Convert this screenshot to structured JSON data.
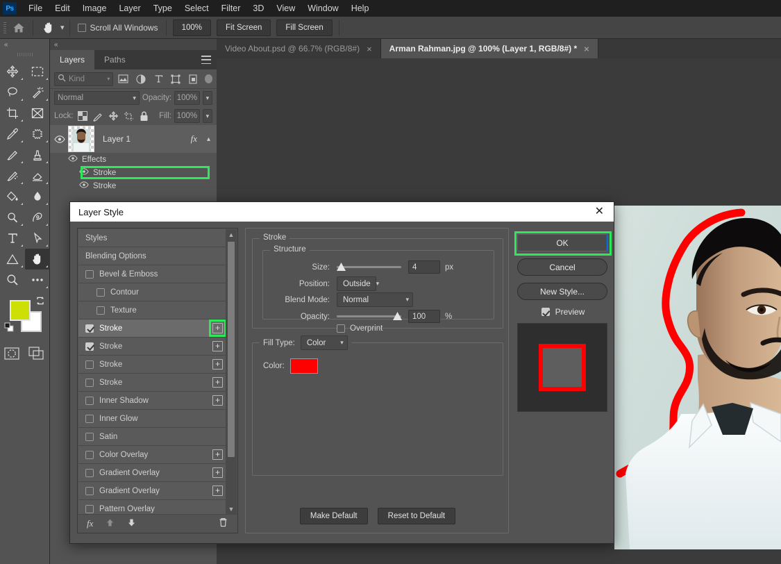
{
  "app": {
    "logo": "Ps",
    "name": "Adobe Photoshop"
  },
  "menubar": {
    "items": [
      "File",
      "Edit",
      "Image",
      "Layer",
      "Type",
      "Select",
      "Filter",
      "3D",
      "View",
      "Window",
      "Help"
    ]
  },
  "options_bar": {
    "home_icon": "home-icon",
    "tool_icon": "hand-tool-icon",
    "scroll_all_windows": {
      "label": "Scroll All Windows",
      "checked": false
    },
    "buttons": [
      {
        "label": "100%",
        "name": "zoom-100-button"
      },
      {
        "label": "Fit Screen",
        "name": "fit-screen-button"
      },
      {
        "label": "Fill Screen",
        "name": "fill-screen-button"
      }
    ]
  },
  "toolbar": {
    "collapse_glyph": "«",
    "tools": [
      {
        "name": "move-tool",
        "icon": "move-icon",
        "active": false,
        "has_flyout": true
      },
      {
        "name": "rectangular-marquee-tool",
        "icon": "marquee-icon",
        "active": false,
        "has_flyout": true
      },
      {
        "name": "lasso-tool",
        "icon": "lasso-icon",
        "active": false,
        "has_flyout": true
      },
      {
        "name": "object-selection-tool",
        "icon": "magic-wand-icon",
        "active": false,
        "has_flyout": true
      },
      {
        "name": "crop-tool",
        "icon": "crop-icon",
        "active": false,
        "has_flyout": true
      },
      {
        "name": "frame-tool",
        "icon": "frame-icon",
        "active": false,
        "has_flyout": false
      },
      {
        "name": "eyedropper-tool",
        "icon": "eyedropper-icon",
        "active": false,
        "has_flyout": true
      },
      {
        "name": "spot-healing-brush-tool",
        "icon": "healing-brush-icon",
        "active": false,
        "has_flyout": true
      },
      {
        "name": "brush-tool",
        "icon": "brush-icon",
        "active": false,
        "has_flyout": true
      },
      {
        "name": "clone-stamp-tool",
        "icon": "clone-stamp-icon",
        "active": false,
        "has_flyout": true
      },
      {
        "name": "history-brush-tool",
        "icon": "history-brush-icon",
        "active": false,
        "has_flyout": true
      },
      {
        "name": "eraser-tool",
        "icon": "eraser-icon",
        "active": false,
        "has_flyout": true
      },
      {
        "name": "gradient-tool",
        "icon": "paint-bucket-icon",
        "active": false,
        "has_flyout": true
      },
      {
        "name": "blur-tool",
        "icon": "blur-drop-icon",
        "active": false,
        "has_flyout": true
      },
      {
        "name": "dodge-tool",
        "icon": "dodge-icon",
        "active": false,
        "has_flyout": true
      },
      {
        "name": "pen-tool",
        "icon": "pen-icon",
        "active": false,
        "has_flyout": true
      },
      {
        "name": "type-tool",
        "icon": "type-t-icon",
        "active": false,
        "has_flyout": true
      },
      {
        "name": "path-selection-tool",
        "icon": "path-arrow-icon",
        "active": false,
        "has_flyout": true
      },
      {
        "name": "shape-tool",
        "icon": "triangle-shape-icon",
        "active": false,
        "has_flyout": true
      },
      {
        "name": "hand-tool",
        "icon": "hand-icon",
        "active": true,
        "has_flyout": true
      },
      {
        "name": "zoom-tool",
        "icon": "magnifier-icon",
        "active": false,
        "has_flyout": false
      },
      {
        "name": "edit-toolbar-tool",
        "icon": "ellipsis-icon",
        "active": false,
        "has_flyout": true
      }
    ],
    "foreground_color": "#cde006",
    "background_color": "#ffffff",
    "swap_icon": "swap-colors-icon",
    "default_colors_icon": "default-colors-icon",
    "quick_mask_icon": "quick-mask-icon",
    "screen_mode_icon": "screen-mode-icon"
  },
  "layers_panel": {
    "collapse_glyph": "«",
    "tabs": [
      {
        "label": "Layers",
        "active": true
      },
      {
        "label": "Paths",
        "active": false
      }
    ],
    "menu_icon": "panel-menu-icon",
    "filter": {
      "kind_label": "Kind",
      "search_icon": "search-icon",
      "icons": [
        "pixel-filter-icon",
        "adjustment-filter-icon",
        "type-filter-icon",
        "shape-filter-icon",
        "smart-object-filter-icon"
      ],
      "toggle_icon": "filter-toggle-icon"
    },
    "blend_mode": "Normal",
    "opacity_label": "Opacity:",
    "opacity_value": "100%",
    "lock_label": "Lock:",
    "lock_icons": [
      "lock-transparent-pixels-icon",
      "lock-image-pixels-icon",
      "lock-position-icon",
      "lock-artboard-icon",
      "lock-all-icon"
    ],
    "fill_label": "Fill:",
    "fill_value": "100%",
    "layer": {
      "name": "Layer 1",
      "eye_icon": "eye-icon",
      "fx_badge": "fx",
      "expand_icon": "chevron-up-icon",
      "effects_label": "Effects",
      "effects": [
        {
          "label": "Stroke",
          "highlighted": true
        },
        {
          "label": "Stroke",
          "highlighted": false
        }
      ]
    }
  },
  "document_tabs": [
    {
      "label": "Video About.psd @ 66.7% (RGB/8#)",
      "active": false,
      "close": "×"
    },
    {
      "label": "Arman Rahman.jpg @ 100% (Layer 1, RGB/8#) *",
      "active": true,
      "close": "×"
    }
  ],
  "dialog": {
    "title": "Layer Style",
    "close_icon": "close-icon",
    "styles_list": [
      {
        "label": "Styles",
        "type": "plain",
        "checkbox": null,
        "plus": false,
        "indent": 0,
        "selected": false
      },
      {
        "label": "Blending Options",
        "type": "plain",
        "checkbox": null,
        "plus": false,
        "indent": 0,
        "selected": false
      },
      {
        "label": "Bevel & Emboss",
        "type": "check",
        "checkbox": false,
        "plus": false,
        "indent": 0,
        "selected": false
      },
      {
        "label": "Contour",
        "type": "check",
        "checkbox": false,
        "plus": false,
        "indent": 1,
        "selected": false
      },
      {
        "label": "Texture",
        "type": "check",
        "checkbox": false,
        "plus": false,
        "indent": 1,
        "selected": false
      },
      {
        "label": "Stroke",
        "type": "check",
        "checkbox": true,
        "plus": true,
        "indent": 0,
        "selected": true,
        "plus_highlighted": true
      },
      {
        "label": "Stroke",
        "type": "check",
        "checkbox": true,
        "plus": true,
        "indent": 0,
        "selected": false
      },
      {
        "label": "Stroke",
        "type": "check",
        "checkbox": false,
        "plus": true,
        "indent": 0,
        "selected": false
      },
      {
        "label": "Stroke",
        "type": "check",
        "checkbox": false,
        "plus": true,
        "indent": 0,
        "selected": false
      },
      {
        "label": "Inner Shadow",
        "type": "check",
        "checkbox": false,
        "plus": true,
        "indent": 0,
        "selected": false
      },
      {
        "label": "Inner Glow",
        "type": "check",
        "checkbox": false,
        "plus": false,
        "indent": 0,
        "selected": false
      },
      {
        "label": "Satin",
        "type": "check",
        "checkbox": false,
        "plus": false,
        "indent": 0,
        "selected": false
      },
      {
        "label": "Color Overlay",
        "type": "check",
        "checkbox": false,
        "plus": true,
        "indent": 0,
        "selected": false
      },
      {
        "label": "Gradient Overlay",
        "type": "check",
        "checkbox": false,
        "plus": true,
        "indent": 0,
        "selected": false
      },
      {
        "label": "Gradient Overlay",
        "type": "check",
        "checkbox": false,
        "plus": true,
        "indent": 0,
        "selected": false
      },
      {
        "label": "Pattern Overlay",
        "type": "check",
        "checkbox": false,
        "plus": false,
        "indent": 0,
        "selected": false
      }
    ],
    "styles_footer": {
      "fx_icon": "fx-add-effect-icon",
      "up_icon": "move-effect-up-icon",
      "down_icon": "move-effect-down-icon",
      "trash_icon": "delete-effect-icon"
    },
    "stroke": {
      "group_label": "Stroke",
      "structure_label": "Structure",
      "size": {
        "label": "Size:",
        "value": "4",
        "unit": "px",
        "slider_pct": 4
      },
      "position": {
        "label": "Position:",
        "value": "Outside"
      },
      "blend_mode": {
        "label": "Blend Mode:",
        "value": "Normal"
      },
      "opacity": {
        "label": "Opacity:",
        "value": "100",
        "unit": "%",
        "slider_pct": 100
      },
      "overprint": {
        "label": "Overprint",
        "checked": false
      },
      "fill_type": {
        "label": "Fill Type:",
        "value": "Color"
      },
      "color": {
        "label": "Color:",
        "value": "#ff0000"
      }
    },
    "default_buttons": [
      {
        "label": "Make Default",
        "name": "make-default-button"
      },
      {
        "label": "Reset to Default",
        "name": "reset-to-default-button"
      }
    ],
    "right_buttons": [
      {
        "label": "OK",
        "name": "ok-button",
        "highlighted": true
      },
      {
        "label": "Cancel",
        "name": "cancel-button",
        "highlighted": false
      },
      {
        "label": "New Style...",
        "name": "new-style-button",
        "highlighted": false
      }
    ],
    "preview": {
      "label": "Preview",
      "checked": true,
      "stroke_color": "#ff0000"
    }
  },
  "highlight_color": "#2ee85c"
}
